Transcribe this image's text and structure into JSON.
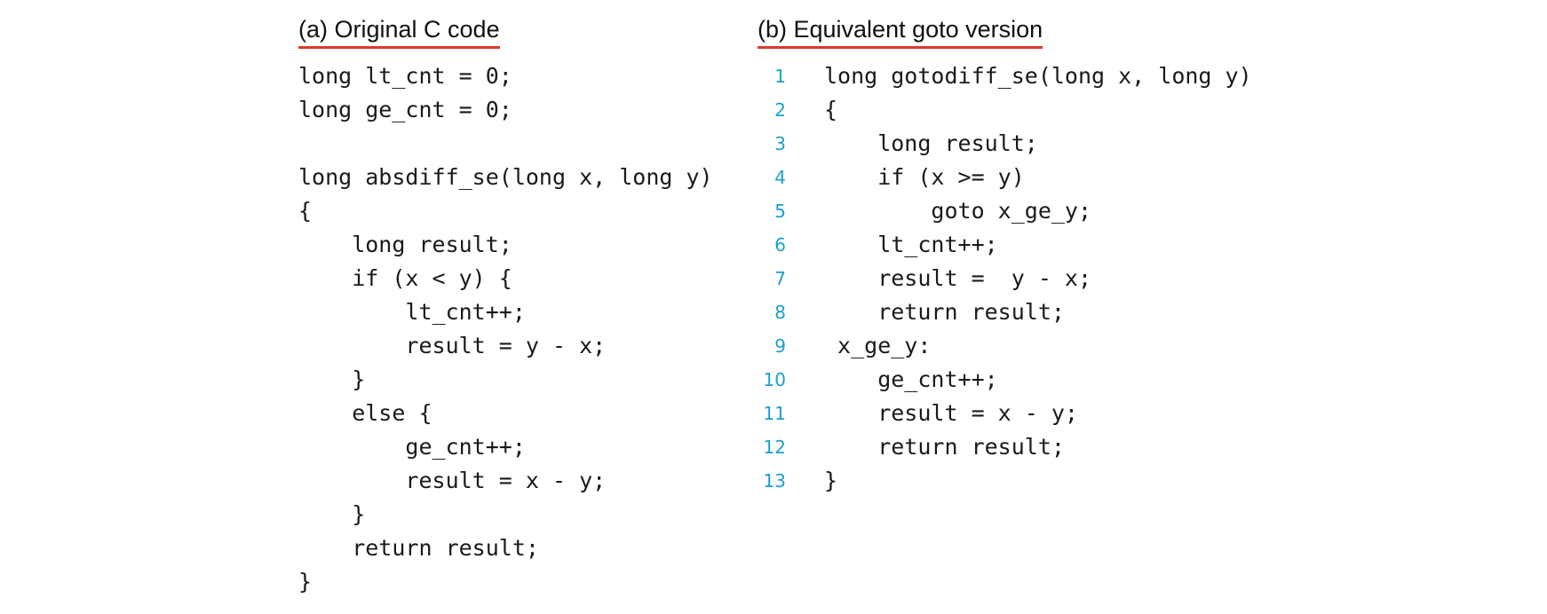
{
  "panel_a": {
    "title": "(a) Original C code",
    "lines": [
      "long lt_cnt = 0;",
      "long ge_cnt = 0;",
      "",
      "long absdiff_se(long x, long y)",
      "{",
      "    long result;",
      "    if (x < y) {",
      "        lt_cnt++;",
      "        result = y - x;",
      "    }",
      "    else {",
      "        ge_cnt++;",
      "        result = x - y;",
      "    }",
      "    return result;",
      "}"
    ]
  },
  "panel_b": {
    "title": "(b) Equivalent goto version",
    "lines": [
      {
        "no": "1",
        "text": "long gotodiff_se(long x, long y)"
      },
      {
        "no": "2",
        "text": "{"
      },
      {
        "no": "3",
        "text": "    long result;"
      },
      {
        "no": "4",
        "text": "    if (x >= y)"
      },
      {
        "no": "5",
        "text": "        goto x_ge_y;"
      },
      {
        "no": "6",
        "text": "    lt_cnt++;"
      },
      {
        "no": "7",
        "text": "    result =  y - x;"
      },
      {
        "no": "8",
        "text": "    return result;"
      },
      {
        "no": "9",
        "text": " x_ge_y:"
      },
      {
        "no": "10",
        "text": "    ge_cnt++;"
      },
      {
        "no": "11",
        "text": "    result = x - y;"
      },
      {
        "no": "12",
        "text": "    return result;"
      },
      {
        "no": "13",
        "text": "}"
      }
    ]
  },
  "colors": {
    "title_underline": "#d93a2b",
    "line_numbers": "#1a9fcf",
    "text": "#1a1a1a"
  }
}
